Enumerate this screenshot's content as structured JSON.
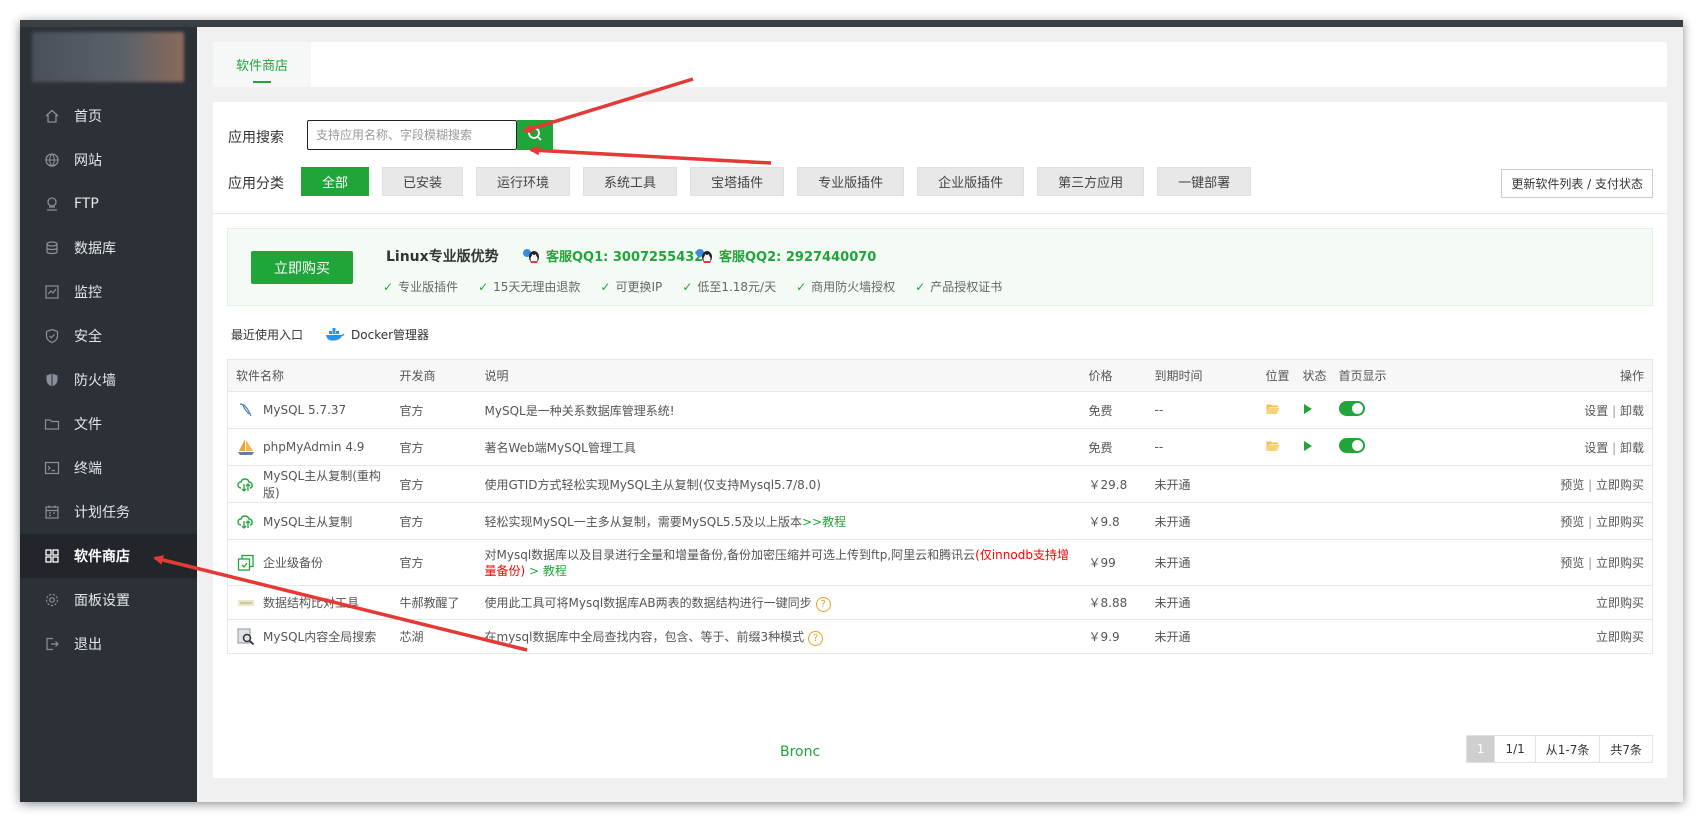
{
  "sidebar": {
    "items": [
      {
        "label": "首页",
        "icon": "home-icon"
      },
      {
        "label": "网站",
        "icon": "globe-icon"
      },
      {
        "label": "FTP",
        "icon": "ftp-icon"
      },
      {
        "label": "数据库",
        "icon": "database-icon"
      },
      {
        "label": "监控",
        "icon": "monitor-icon"
      },
      {
        "label": "安全",
        "icon": "shield-check-icon"
      },
      {
        "label": "防火墙",
        "icon": "firewall-icon"
      },
      {
        "label": "文件",
        "icon": "folder-icon"
      },
      {
        "label": "终端",
        "icon": "terminal-icon"
      },
      {
        "label": "计划任务",
        "icon": "calendar-icon"
      },
      {
        "label": "软件商店",
        "icon": "apps-grid-icon",
        "active": true
      },
      {
        "label": "面板设置",
        "icon": "gear-icon"
      },
      {
        "label": "退出",
        "icon": "logout-icon"
      }
    ]
  },
  "tabs": {
    "store": "软件商店"
  },
  "search": {
    "label": "应用搜索",
    "placeholder": "支持应用名称、字段模糊搜索",
    "value": ""
  },
  "categories": {
    "label": "应用分类",
    "items": [
      "全部",
      "已安装",
      "运行环境",
      "系统工具",
      "宝塔插件",
      "专业版插件",
      "企业版插件",
      "第三方应用",
      "一键部署"
    ],
    "active": "全部"
  },
  "update_button": "更新软件列表 / 支付状态",
  "promo": {
    "buy_label": "立即购买",
    "title": "Linux专业版优势",
    "qq1": "客服QQ1: 3007255432",
    "qq2": "客服QQ2: 2927440070",
    "features": [
      "专业版插件",
      "15天无理由退款",
      "可更换IP",
      "低至1.18元/天",
      "商用防火墙授权",
      "产品授权证书"
    ]
  },
  "recent": {
    "label": "最近使用入口",
    "docker": "Docker管理器"
  },
  "table": {
    "headers": [
      "软件名称",
      "开发商",
      "说明",
      "价格",
      "到期时间",
      "位置",
      "状态",
      "首页显示",
      "操作"
    ],
    "rows": [
      {
        "name": "MySQL 5.7.37",
        "dev": "官方",
        "desc": "MySQL是一种关系数据库管理系统!",
        "price": "免费",
        "expire": "--",
        "installed": true,
        "op1": "设置",
        "op2": "卸载"
      },
      {
        "name": "phpMyAdmin 4.9",
        "dev": "官方",
        "desc": "著名Web端MySQL管理工具",
        "price": "免费",
        "expire": "--",
        "installed": true,
        "op1": "设置",
        "op2": "卸载"
      },
      {
        "name": "MySQL主从复制(重构版)",
        "dev": "官方",
        "desc": "使用GTID方式轻松实现MySQL主从复制(仅支持Mysql5.7/8.0)",
        "price": "￥29.8",
        "expire": "未开通",
        "op1": "预览",
        "op2": "立即购买"
      },
      {
        "name": "MySQL主从复制",
        "dev": "官方",
        "desc": "轻松实现MySQL一主多从复制，需要MySQL5.5及以上版本",
        "desc_link": ">>教程",
        "price": "￥9.8",
        "expire": "未开通",
        "op1": "预览",
        "op2": "立即购买"
      },
      {
        "name": "企业级备份",
        "dev": "官方",
        "desc": "对Mysql数据库以及目录进行全量和增量备份,备份加密压缩并可选上传到ftp,阿里云和腾讯云",
        "desc_red": "(仅innodb支持增量备份)",
        "desc_link": "> 教程",
        "price": "￥99",
        "expire": "未开通",
        "op1": "预览",
        "op2": "立即购买"
      },
      {
        "name": "数据结构比对工具",
        "dev": "牛郝教醒了",
        "desc": "使用此工具可将Mysql数据库AB两表的数据结构进行一键同步",
        "price": "￥8.88",
        "expire": "未开通",
        "op2": "立即购买",
        "help": "?"
      },
      {
        "name": "MySQL内容全局搜索",
        "dev": "芯湖",
        "desc": "在mysql数据库中全局查找内容，包含、等于、前缀3种模式",
        "price": "￥9.9",
        "expire": "未开通",
        "op2": "立即购买",
        "help": "?"
      }
    ]
  },
  "pager": {
    "current": "1",
    "pages": "1/1",
    "range": "从1-7条",
    "total": "共7条"
  },
  "footer": {
    "text": "Bronc"
  },
  "colors": {
    "accent": "#20a53a",
    "sidebar": "#2c3138",
    "price": "#ff5722",
    "arrow": "#e53935"
  }
}
